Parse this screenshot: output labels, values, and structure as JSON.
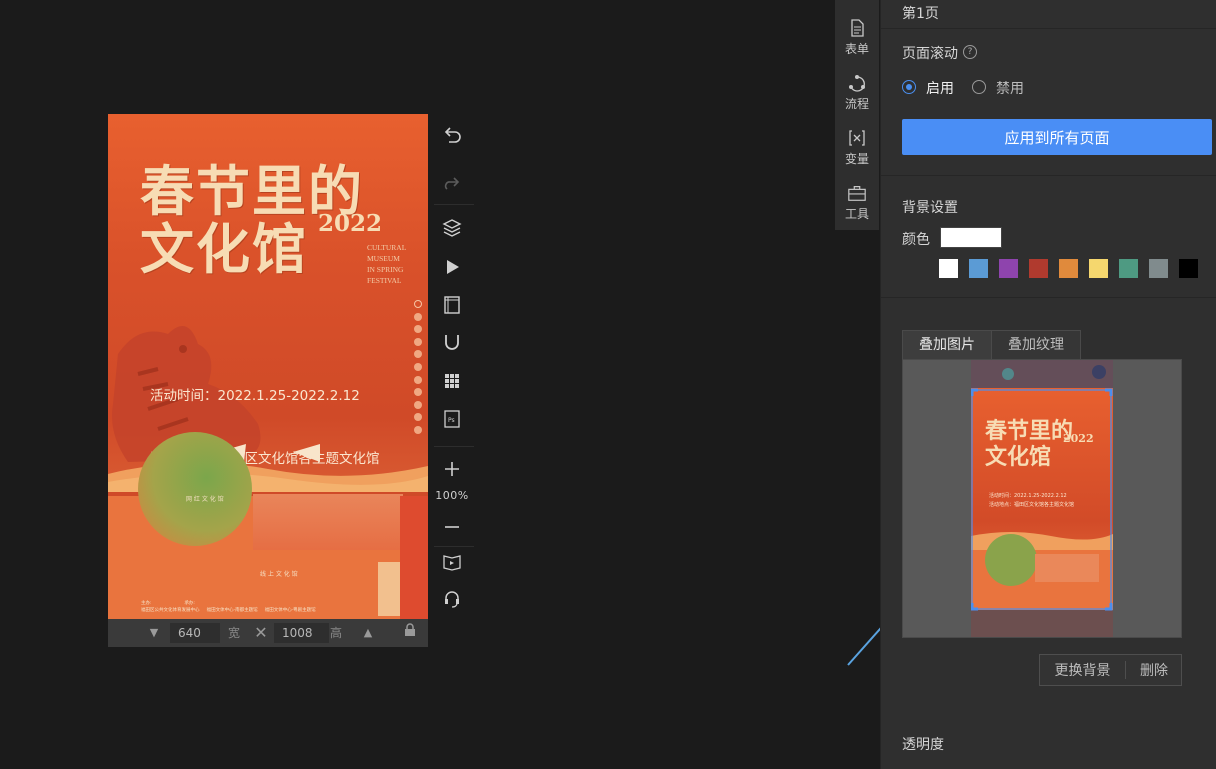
{
  "poster": {
    "title_main": "春节里的\n文化馆",
    "year": "2022",
    "title_en": "CULTURAL\nMUSEUM\nIN SPRING\nFESTIVAL",
    "info_time": "活动时间：2022.1.25-2022.2.12",
    "info_place": "活动地点：福田区文化馆各主题文化馆",
    "lower_label_1": "网 红 文 化 馆",
    "lower_label_2": "线 上 文 化 馆",
    "lower_footer": "主办:                       承办:\n福田区公共文化体育发展中心     福田文体中心·南都主题馆     福田文体中心·粤剧主题馆"
  },
  "sizebar": {
    "width_value": "640",
    "width_unit": "宽",
    "height_value": "1008",
    "height_unit": "高"
  },
  "zoom": {
    "level": "100%"
  },
  "side_nav": {
    "form": "表单",
    "flow": "流程",
    "variable": "变量",
    "tools": "工具"
  },
  "panel": {
    "page_name": "第1页",
    "scroll_title": "页面滚动",
    "enable_label": "启用",
    "disable_label": "禁用",
    "apply_button": "应用到所有页面",
    "bg_title": "背景设置",
    "color_label": "颜色",
    "swatches": [
      "#ffffff",
      "#5b9bd5",
      "#8e44ad",
      "#b03a2e",
      "#e08a3c",
      "#f5d76e",
      "#4e9a82",
      "#808b8d",
      "#000000"
    ],
    "tab_image": "叠加图片",
    "tab_texture": "叠加纹理",
    "replace_bg": "更换背景",
    "delete": "删除",
    "opacity_title": "透明度"
  },
  "thumb": {
    "title": "春节里的\n文化馆",
    "year": "2022",
    "info": "活动时间：2022.1.25-2022.2.12\n活动地点：福田区文化馆各主题文化馆"
  },
  "colors": {
    "accent": "#4a8ef5",
    "panel_bg": "#2f2f2f",
    "canvas_bg": "#1b1b1b",
    "poster_red": "#d9512a"
  }
}
